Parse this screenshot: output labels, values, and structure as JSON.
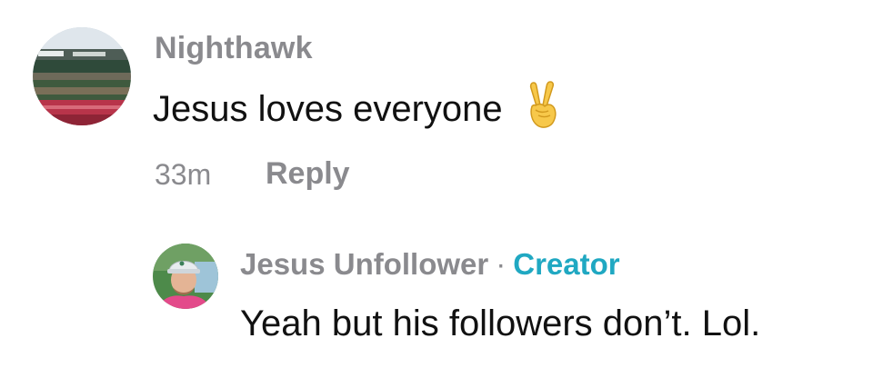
{
  "comments": [
    {
      "username": "Nighthawk",
      "text": "Jesus loves everyone",
      "emoji": "victory-hand-emoji",
      "time": "33m",
      "reply_label": "Reply"
    }
  ],
  "reply": {
    "username": "Jesus Unfollower",
    "separator": "·",
    "badge": "Creator",
    "text": "Yeah but his followers don’t. Lol."
  },
  "colors": {
    "muted": "#8a8a8e",
    "text": "#111111",
    "creator_badge": "#20a8c2"
  }
}
